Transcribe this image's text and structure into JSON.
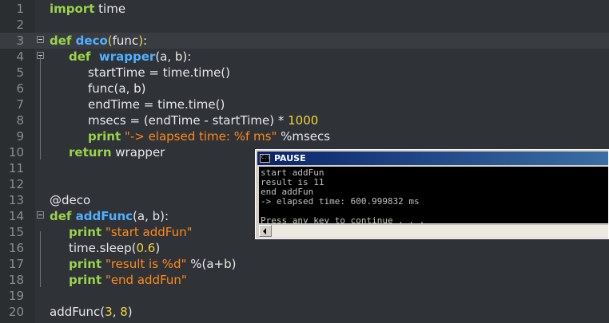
{
  "editor": {
    "lines": [
      {
        "num": "1",
        "indent": 62,
        "tokens": [
          [
            "kw",
            "import"
          ],
          [
            "t",
            " time"
          ]
        ]
      },
      {
        "num": "2",
        "indent": 62,
        "tokens": []
      },
      {
        "num": "3",
        "indent": 62,
        "tokens": [
          [
            "kw",
            "def "
          ],
          [
            "fn",
            "deco"
          ],
          [
            "br",
            "("
          ],
          [
            "t",
            "func"
          ],
          [
            "br",
            ")"
          ],
          [
            "t",
            ":"
          ]
        ],
        "fold": true,
        "hl": true
      },
      {
        "num": "4",
        "indent": 86,
        "tokens": [
          [
            "kw",
            "def "
          ],
          [
            "fn",
            " wrapper"
          ],
          [
            "t",
            "(a, b):"
          ]
        ],
        "fold": true
      },
      {
        "num": "5",
        "indent": 110,
        "tokens": [
          [
            "t",
            "startTime = time.time()"
          ]
        ]
      },
      {
        "num": "6",
        "indent": 110,
        "tokens": [
          [
            "t",
            "func(a, b)"
          ]
        ]
      },
      {
        "num": "7",
        "indent": 110,
        "tokens": [
          [
            "t",
            "endTime = time.time()"
          ]
        ]
      },
      {
        "num": "8",
        "indent": 110,
        "tokens": [
          [
            "t",
            "msecs = (endTime - startTime) * "
          ],
          [
            "num",
            "1000"
          ]
        ]
      },
      {
        "num": "9",
        "indent": 110,
        "tokens": [
          [
            "kw",
            "print"
          ],
          [
            "t",
            " "
          ],
          [
            "str",
            "\"-> elapsed time: %f ms\""
          ],
          [
            "t",
            " %msecs"
          ]
        ]
      },
      {
        "num": "10",
        "indent": 86,
        "tokens": [
          [
            "kw",
            "return"
          ],
          [
            "t",
            " wrapper"
          ]
        ]
      },
      {
        "num": "11",
        "indent": 62,
        "tokens": []
      },
      {
        "num": "12",
        "indent": 62,
        "tokens": []
      },
      {
        "num": "13",
        "indent": 62,
        "tokens": [
          [
            "t",
            "@deco"
          ]
        ]
      },
      {
        "num": "14",
        "indent": 62,
        "tokens": [
          [
            "kw",
            "def "
          ],
          [
            "fn",
            "addFunc"
          ],
          [
            "t",
            "(a, b):"
          ]
        ],
        "fold": true
      },
      {
        "num": "15",
        "indent": 86,
        "tokens": [
          [
            "kw",
            "print"
          ],
          [
            "t",
            " "
          ],
          [
            "str",
            "\"start addFun\""
          ]
        ]
      },
      {
        "num": "16",
        "indent": 86,
        "tokens": [
          [
            "t",
            "time.sleep("
          ],
          [
            "num",
            "0.6"
          ],
          [
            "t",
            ")"
          ]
        ]
      },
      {
        "num": "17",
        "indent": 86,
        "tokens": [
          [
            "kw",
            "print"
          ],
          [
            "t",
            " "
          ],
          [
            "str",
            "\"result is %d\""
          ],
          [
            "t",
            " %(a+b)"
          ]
        ]
      },
      {
        "num": "18",
        "indent": 86,
        "tokens": [
          [
            "kw",
            "print"
          ],
          [
            "t",
            " "
          ],
          [
            "str",
            "\"end addFun\""
          ]
        ]
      },
      {
        "num": "19",
        "indent": 62,
        "tokens": []
      },
      {
        "num": "20",
        "indent": 62,
        "tokens": [
          [
            "t",
            "addFunc("
          ],
          [
            "num",
            "3"
          ],
          [
            "t",
            ", "
          ],
          [
            "num",
            "8"
          ],
          [
            "t",
            ")"
          ]
        ]
      }
    ]
  },
  "console": {
    "title": "PAUSE",
    "icon_text": "C:\\",
    "output": [
      "start addFun",
      "result is 11",
      "end addFun",
      "-> elapsed time: 600.999832 ms",
      "",
      "Press any key to continue . . ."
    ]
  }
}
